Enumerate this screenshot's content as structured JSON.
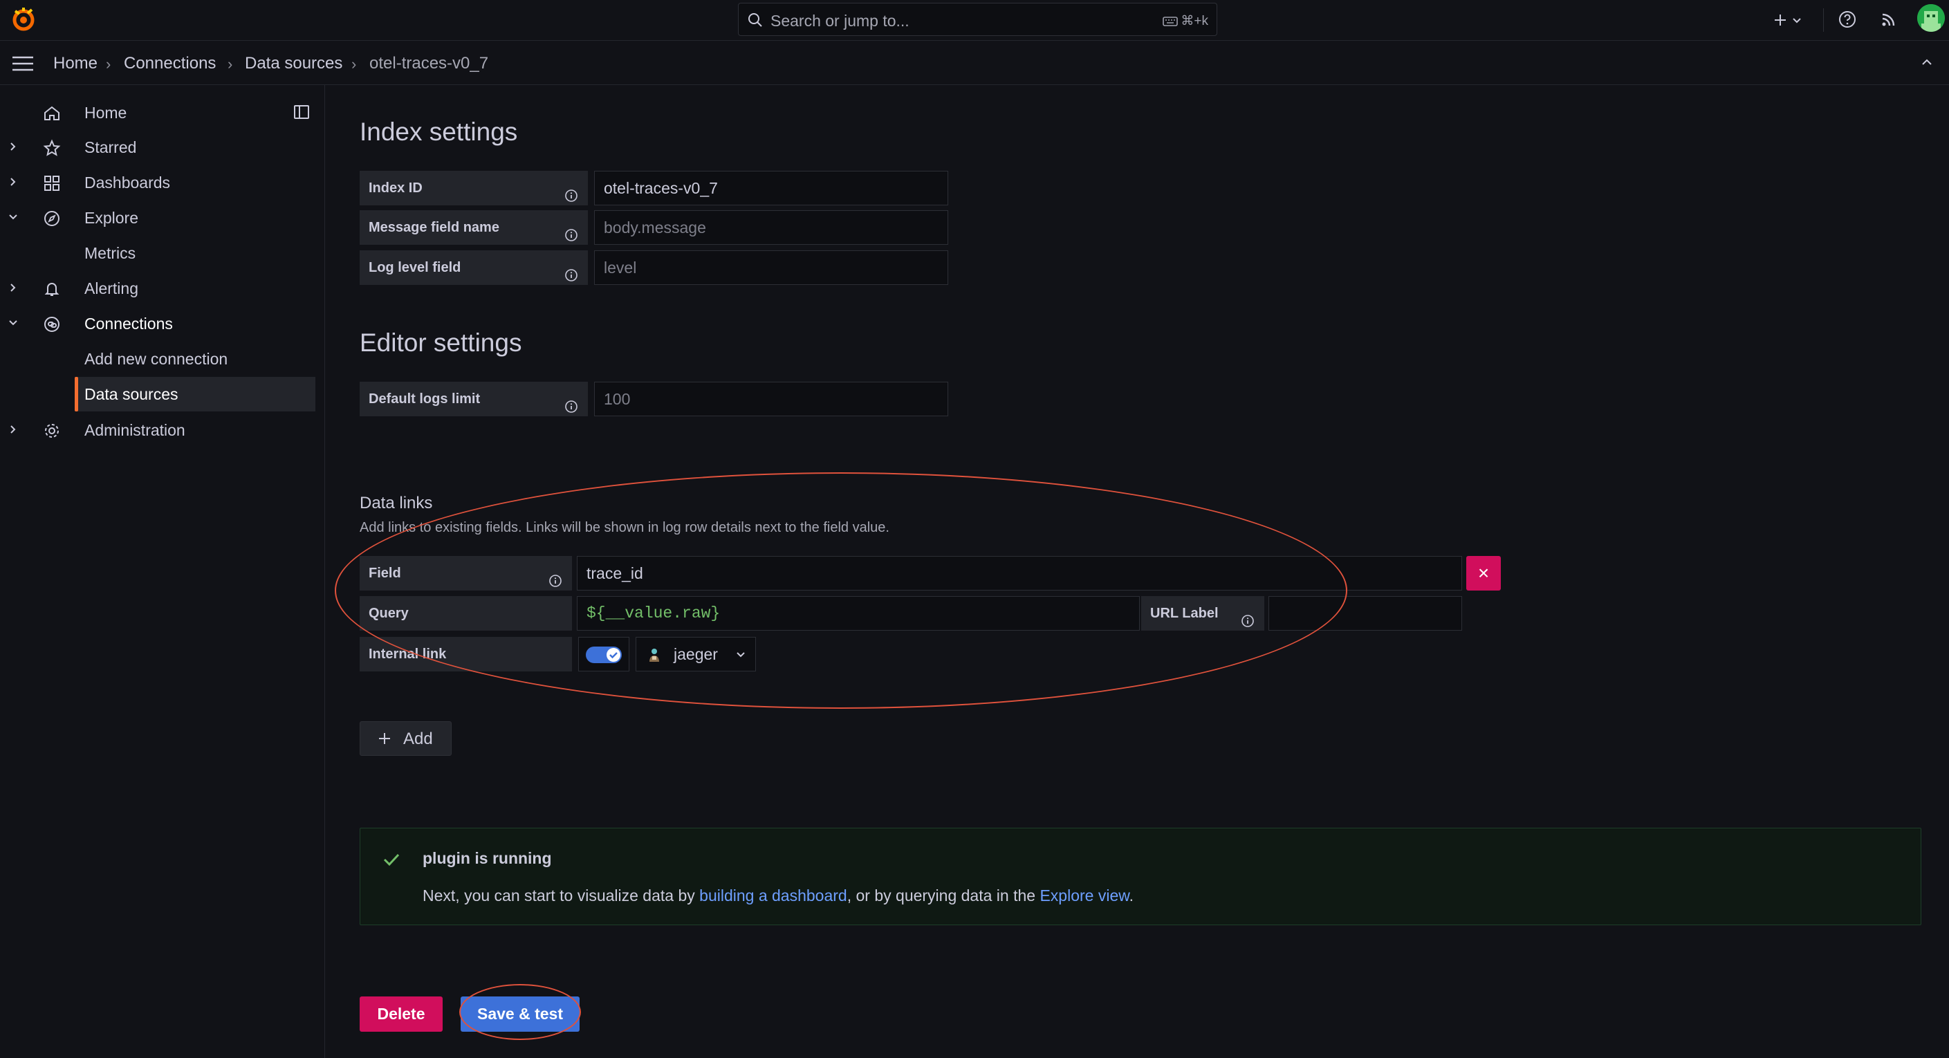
{
  "topbar": {
    "search_placeholder": "Search or jump to...",
    "search_shortcut": "⌘+k",
    "plus_icon": "plus-icon",
    "help_icon": "help-circle-icon",
    "news_icon": "rss-icon"
  },
  "breadcrumbs": [
    "Home",
    "Connections",
    "Data sources",
    "otel-traces-v0_7"
  ],
  "sidebar": {
    "items": [
      {
        "label": "Home",
        "icon": "home-icon"
      },
      {
        "label": "Starred",
        "icon": "star-icon"
      },
      {
        "label": "Dashboards",
        "icon": "apps-icon"
      },
      {
        "label": "Explore",
        "icon": "compass-icon"
      },
      {
        "label": "Metrics"
      },
      {
        "label": "Alerting",
        "icon": "bell-icon"
      },
      {
        "label": "Connections",
        "icon": "link-icon"
      },
      {
        "label": "Add new connection"
      },
      {
        "label": "Data sources"
      },
      {
        "label": "Administration",
        "icon": "cog-icon"
      }
    ]
  },
  "index_settings": {
    "title": "Index settings",
    "fields": [
      {
        "label": "Index ID",
        "value": "otel-traces-v0_7",
        "placeholder": ""
      },
      {
        "label": "Message field name",
        "value": "",
        "placeholder": "body.message"
      },
      {
        "label": "Log level field",
        "value": "",
        "placeholder": "level"
      }
    ]
  },
  "editor_settings": {
    "title": "Editor settings",
    "fields": [
      {
        "label": "Default logs limit",
        "value": "",
        "placeholder": "100"
      }
    ]
  },
  "data_links": {
    "title": "Data links",
    "description": "Add links to existing fields. Links will be shown in log row details next to the field value.",
    "field_label": "Field",
    "field_value": "trace_id",
    "query_label": "Query",
    "query_value": "${__value.raw}",
    "url_label_label": "URL Label",
    "url_label_value": "",
    "internal_link_label": "Internal link",
    "internal_link_enabled": true,
    "datasource": "jaeger",
    "remove_symbol": "×",
    "add_label": "Add"
  },
  "alert": {
    "title": "plugin is running",
    "body_prefix": "Next, you can start to visualize data by ",
    "link1": "building a dashboard",
    "body_middle": ", or by querying data in the ",
    "link2": "Explore view",
    "body_suffix": "."
  },
  "actions": {
    "delete_label": "Delete",
    "save_label": "Save & test"
  },
  "colors": {
    "background": "#111217",
    "primary": "#3d71d9",
    "destructive": "#d10e5c",
    "success": "#73bf69",
    "accent": "#f56e30",
    "annotation": "#e0523c"
  }
}
